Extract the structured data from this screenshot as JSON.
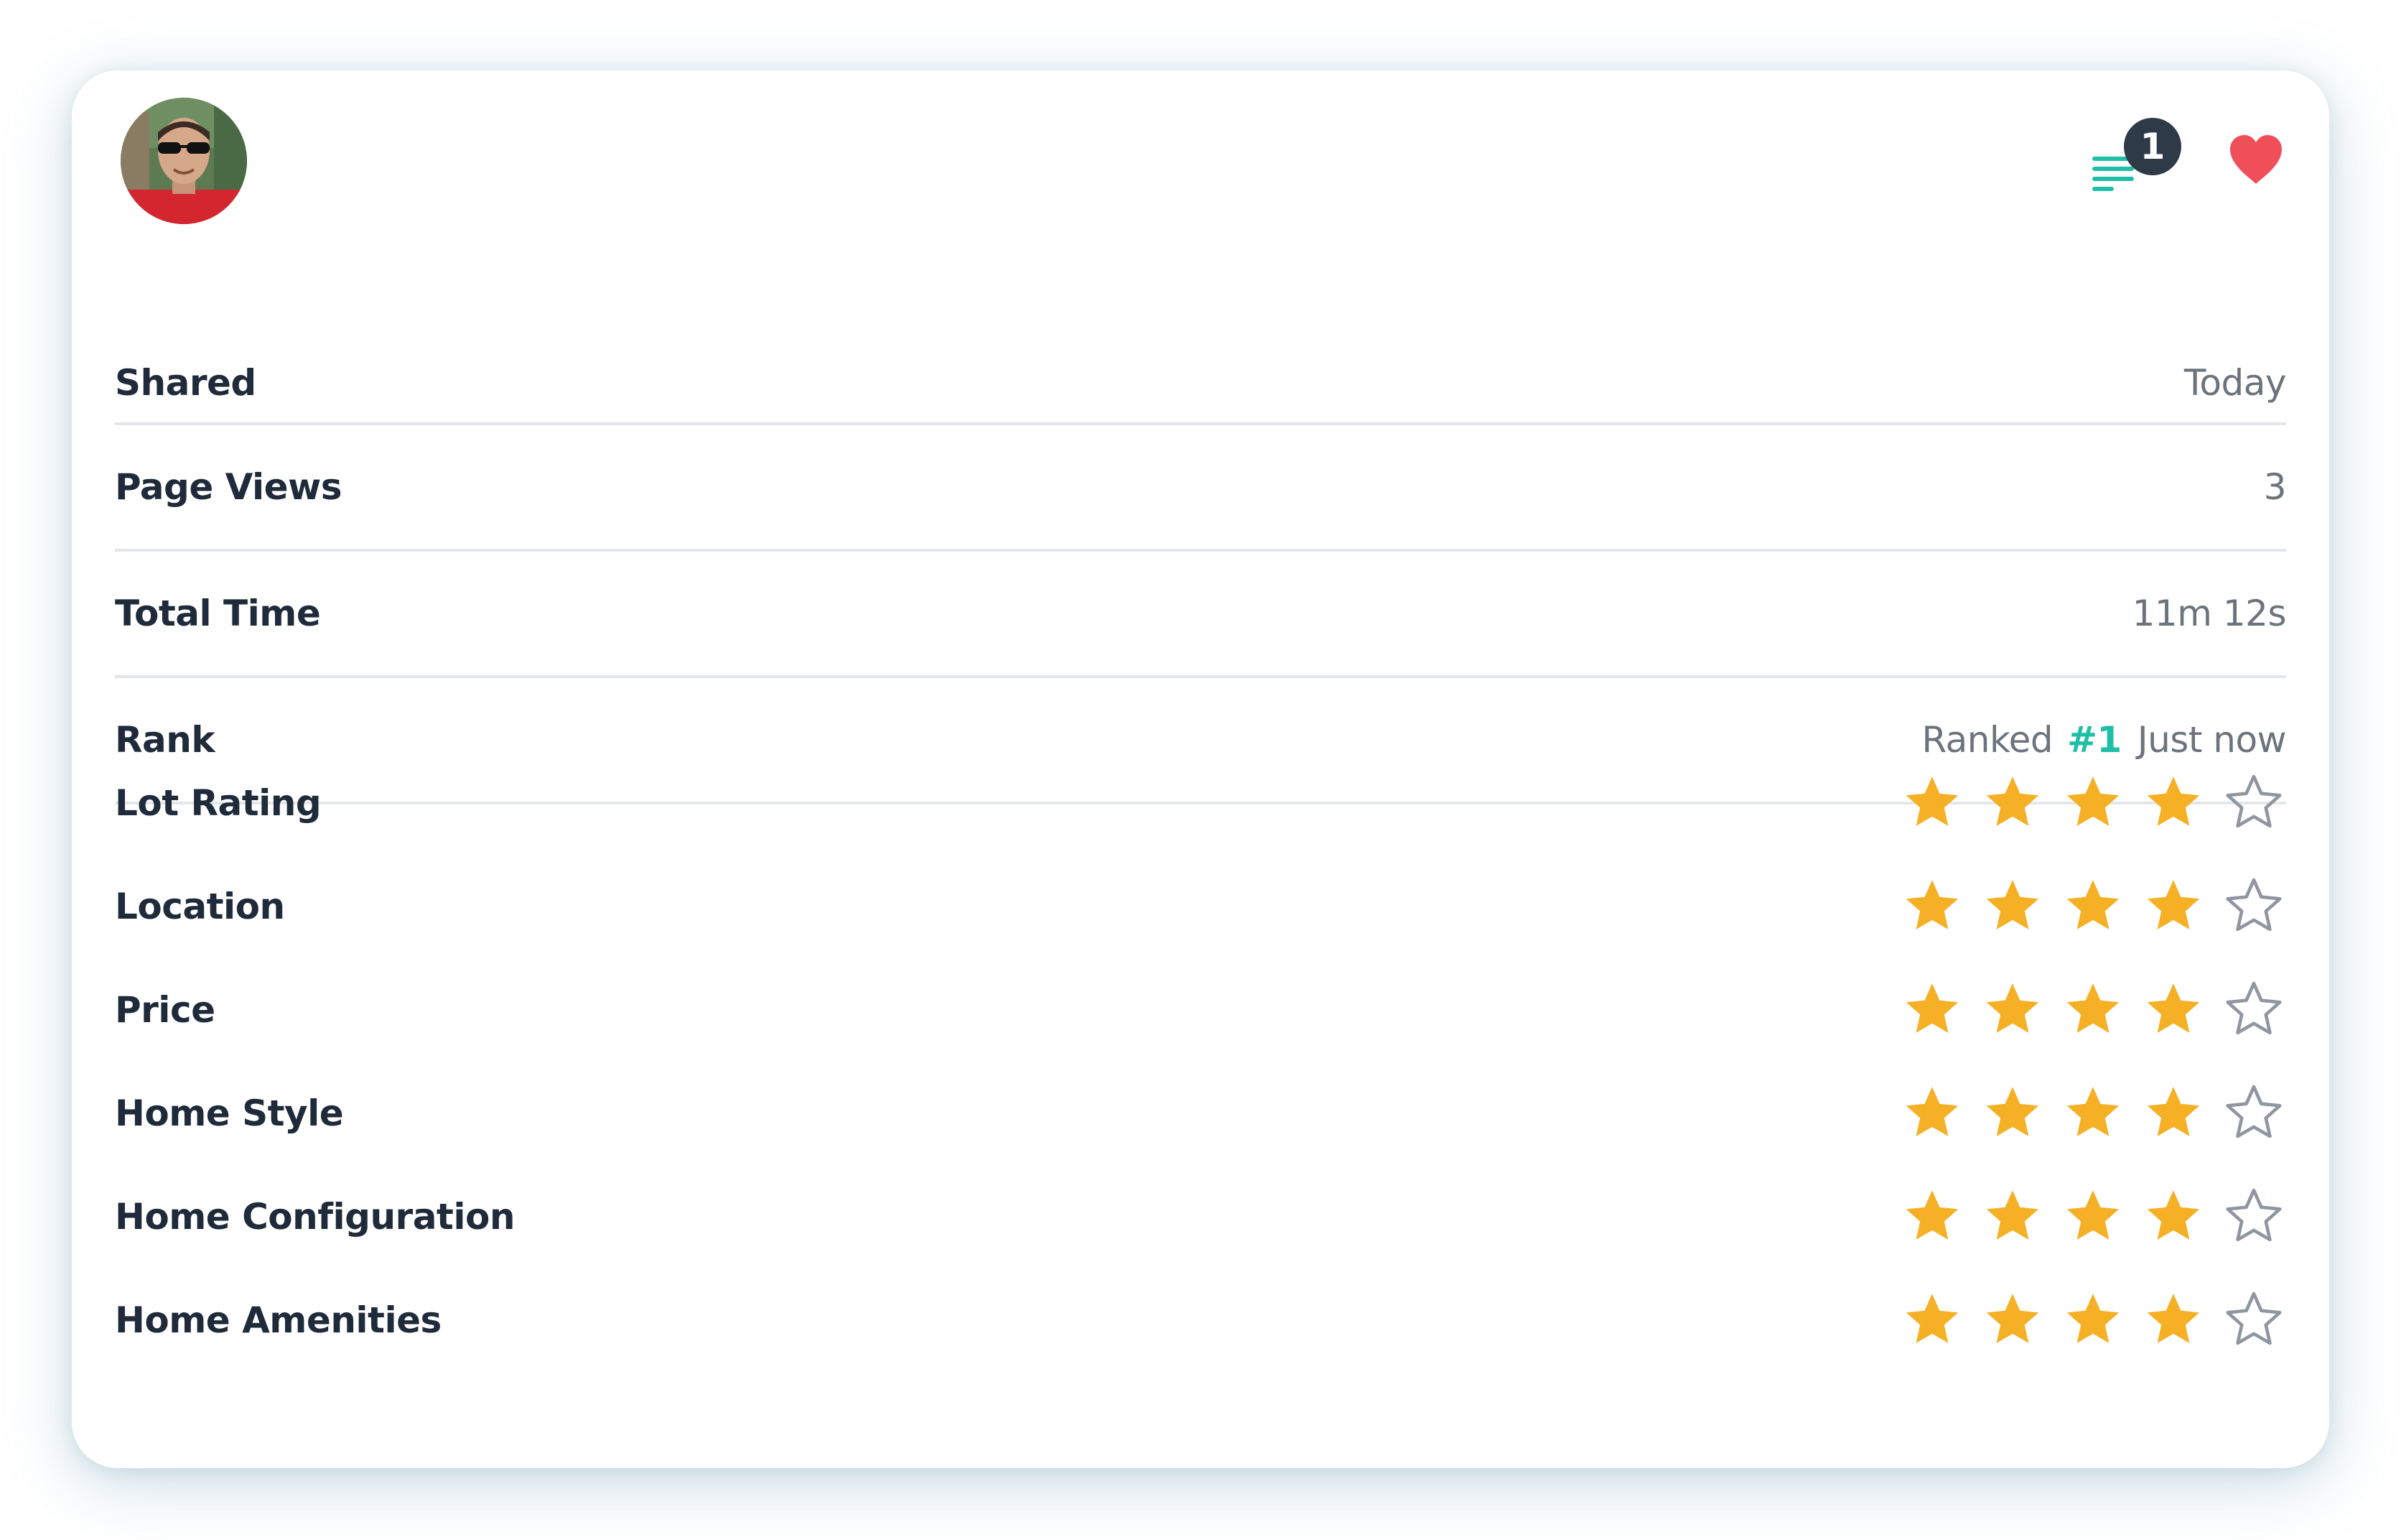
{
  "header": {
    "avatar_alt": "User avatar",
    "notes_badge_count": "1",
    "favorite_icon": "heart-icon",
    "notes_icon": "notes-lines-icon"
  },
  "stats": [
    {
      "label": "Shared",
      "value": "Today"
    },
    {
      "label": "Page Views",
      "value": "3"
    },
    {
      "label": "Total Time",
      "value": "11m 12s"
    }
  ],
  "rank": {
    "label": "Rank",
    "prefix": "Ranked",
    "number": "#1",
    "suffix": "Just now"
  },
  "ratings": [
    {
      "label": "Lot Rating",
      "stars": 4,
      "max": 5
    },
    {
      "label": "Location",
      "stars": 4,
      "max": 5
    },
    {
      "label": "Price",
      "stars": 4,
      "max": 5
    },
    {
      "label": "Home Style",
      "stars": 4,
      "max": 5
    },
    {
      "label": "Home Configuration",
      "stars": 4,
      "max": 5
    },
    {
      "label": "Home Amenities",
      "stars": 4,
      "max": 5
    }
  ],
  "colors": {
    "accent_teal": "#1fbfa7",
    "heart_red": "#ef4f58",
    "star_filled": "#f5b025",
    "star_empty": "#8f96a2",
    "badge_bg": "#2f3a48",
    "label_text": "#1f2b3a",
    "value_text": "#6c737c"
  }
}
